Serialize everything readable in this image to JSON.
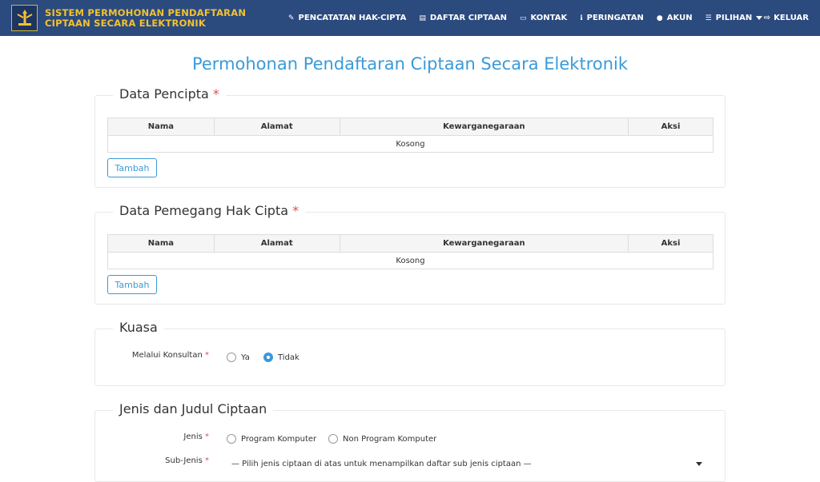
{
  "header": {
    "brand_line1": "SISTEM PERMOHONAN PENDAFTARAN",
    "brand_line2": "CIPTAAN SECARA ELEKTRONIK",
    "nav": [
      {
        "label": "PENCATATAN HAK-CIPTA",
        "icon": "pencil-icon"
      },
      {
        "label": "DAFTAR CIPTAAN",
        "icon": "document-icon"
      },
      {
        "label": "KONTAK",
        "icon": "card-icon"
      },
      {
        "label": "PERINGATAN",
        "icon": "info-icon"
      },
      {
        "label": "AKUN",
        "icon": "user-icon"
      },
      {
        "label": "PILIHAN",
        "icon": "menu-icon"
      }
    ],
    "logout_label": "KELUAR"
  },
  "page_title": "Permohonan Pendaftaran Ciptaan Secara Elektronik",
  "pencipta": {
    "legend": "Data Pencipta",
    "required_mark": "*",
    "columns": [
      "Nama",
      "Alamat",
      "Kewarganegaraan",
      "Aksi"
    ],
    "empty_text": "Kosong",
    "add_label": "Tambah"
  },
  "pemegang": {
    "legend": "Data Pemegang Hak Cipta",
    "required_mark": "*",
    "columns": [
      "Nama",
      "Alamat",
      "Kewarganegaraan",
      "Aksi"
    ],
    "empty_text": "Kosong",
    "add_label": "Tambah"
  },
  "kuasa": {
    "legend": "Kuasa",
    "label": "Melalui Konsultan",
    "required_mark": "*",
    "options": [
      "Ya",
      "Tidak"
    ],
    "selected": "Tidak"
  },
  "jenis": {
    "legend": "Jenis dan Judul Ciptaan",
    "jenis_label": "Jenis",
    "required_mark": "*",
    "options": [
      "Program Komputer",
      "Non Program Komputer"
    ],
    "subjenis_label": "Sub-Jenis",
    "subjenis_placeholder": "— Pilih jenis ciptaan di atas untuk menampilkan daftar sub jenis ciptaan —"
  },
  "colors": {
    "navbar": "#2b4a7e",
    "brand_text": "#f2c230",
    "accent": "#3a9ad9",
    "required": "#d9534f"
  }
}
